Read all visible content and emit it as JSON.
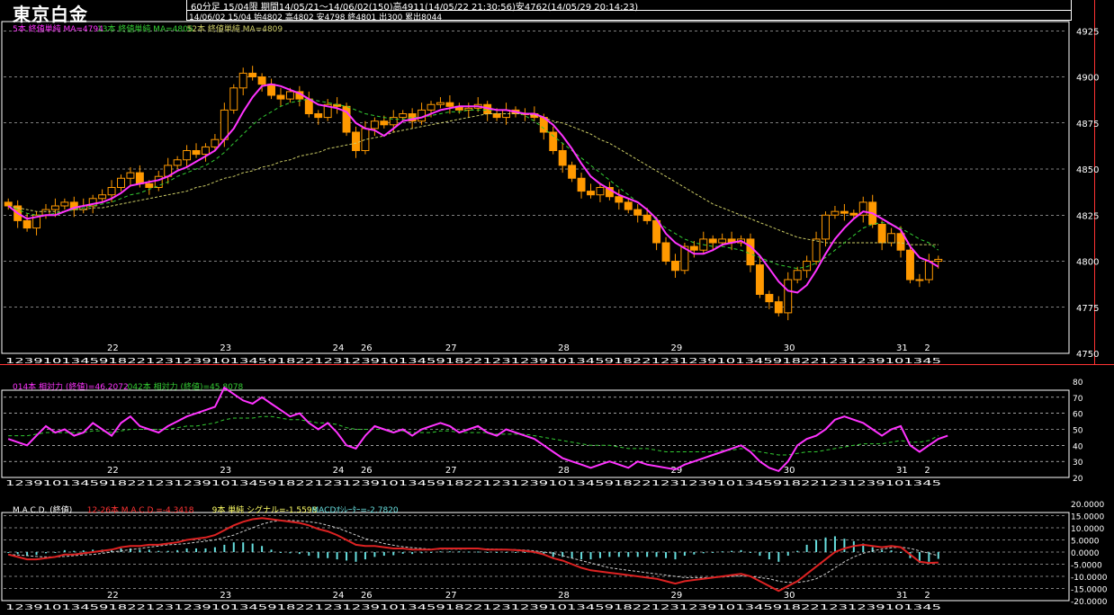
{
  "header": {
    "title": "東京白金",
    "info_line1": "60分足  15/04限  期間14/05/21～14/06/02(150)高4911(14/05/22 21:30:56)安4762(14/05/29 20:14:23)",
    "info_line2": "14/06/02 15/04 始4802 高4802 安4798 終4801 出300 累出8044"
  },
  "colors": {
    "candle": "#ff9900",
    "ma5": "#ff33ff",
    "ma13": "#33cc33",
    "ma52": "#cccc66",
    "rsi14": "#ff33ff",
    "rsi42": "#33cc33",
    "macd": "#dd2222",
    "signal": "#cccccc",
    "osc": "#66dddd",
    "panel_border": "#ff3333"
  },
  "x_axis": {
    "day_labels": [
      {
        "label": "22",
        "idx": 11
      },
      {
        "label": "23",
        "idx": 23
      },
      {
        "label": "24",
        "idx": 35
      },
      {
        "label": "26",
        "idx": 38
      },
      {
        "label": "27",
        "idx": 47
      },
      {
        "label": "28",
        "idx": 59
      },
      {
        "label": "29",
        "idx": 71
      },
      {
        "label": "30",
        "idx": 83
      },
      {
        "label": "31",
        "idx": 95
      },
      {
        "label": "2",
        "idx": 98
      }
    ],
    "hour_pattern": "123910134591822123"
  },
  "price_panel": {
    "legend": [
      {
        "text": "5本 終値単純 MA=4794",
        "color": "#ff33ff"
      },
      {
        "text": "13本 終値単純 MA=4806",
        "color": "#33cc33"
      },
      {
        "text": "52本 終値単純 MA=4809",
        "color": "#cccc66"
      }
    ],
    "y_ticks": [
      "4925",
      "4900",
      "4875",
      "4850",
      "4825",
      "4800",
      "4775",
      "4750"
    ]
  },
  "rsi_panel": {
    "legend": [
      {
        "text": "014本 相対力 (終値)=46.2072",
        "color": "#ff33ff"
      },
      {
        "text": "042本 相対力 (終値)=45.8078",
        "color": "#33cc33"
      }
    ],
    "y_ticks": [
      "80",
      "70",
      "60",
      "50",
      "40",
      "30",
      "20"
    ]
  },
  "macd_panel": {
    "legend": [
      {
        "text": "M.A.C.D. (終値)",
        "color": "#ffffff"
      },
      {
        "text": "12-26本 M.A.C.D.=-4.3418",
        "color": "#ff3333"
      },
      {
        "text": "9本 単純 シグナル=-1.5598",
        "color": "#ffff66"
      },
      {
        "text": "MACDｵｼﾚｰﾀｰ=-2.7820",
        "color": "#66dddd"
      }
    ],
    "y_ticks": [
      "20.0000",
      "15.0000",
      "10.0000",
      "5.0000",
      "0.0000",
      "-5.0000",
      "-10.0000",
      "-15.0000",
      "-20.0000"
    ]
  },
  "chart_data": {
    "type": "candlestick",
    "n_bars": 100,
    "price_ylim": [
      4750,
      4930
    ],
    "rsi_ylim": [
      20,
      80
    ],
    "macd_ylim": [
      -20,
      20
    ],
    "close": [
      4830,
      4822,
      4818,
      4825,
      4828,
      4830,
      4832,
      4828,
      4830,
      4834,
      4836,
      4840,
      4845,
      4848,
      4842,
      4840,
      4846,
      4852,
      4855,
      4860,
      4858,
      4862,
      4866,
      4882,
      4894,
      4902,
      4900,
      4896,
      4890,
      4888,
      4892,
      4888,
      4880,
      4878,
      4885,
      4884,
      4870,
      4860,
      4872,
      4876,
      4874,
      4878,
      4880,
      4876,
      4882,
      4885,
      4886,
      4884,
      4882,
      4883,
      4885,
      4880,
      4878,
      4882,
      4880,
      4880,
      4878,
      4870,
      4860,
      4852,
      4845,
      4838,
      4836,
      4840,
      4835,
      4832,
      4828,
      4825,
      4822,
      4810,
      4800,
      4795,
      4808,
      4806,
      4812,
      4810,
      4812,
      4810,
      4812,
      4798,
      4782,
      4778,
      4772,
      4790,
      4795,
      4800,
      4812,
      4825,
      4827,
      4826,
      4825,
      4832,
      4820,
      4810,
      4815,
      4806,
      4790,
      4790,
      4800,
      4801
    ],
    "ma5": [
      4830,
      4826,
      4823,
      4824,
      4825,
      4825,
      4827,
      4829,
      4830,
      4831,
      4832,
      4834,
      4837,
      4841,
      4842,
      4843,
      4844,
      4846,
      4849,
      4851,
      4854,
      4857,
      4860,
      4866,
      4872,
      4881,
      4889,
      4895,
      4896,
      4895,
      4893,
      4891,
      4888,
      4885,
      4884,
      4883,
      4881,
      4875,
      4872,
      4871,
      4868,
      4872,
      4876,
      4877,
      4878,
      4880,
      4882,
      4883,
      4884,
      4884,
      4884,
      4883,
      4882,
      4882,
      4881,
      4880,
      4880,
      4878,
      4874,
      4868,
      4861,
      4853,
      4846,
      4842,
      4839,
      4836,
      4834,
      4832,
      4828,
      4823,
      4815,
      4810,
      4807,
      4804,
      4804,
      4806,
      4809,
      4810,
      4811,
      4808,
      4803,
      4796,
      4789,
      4784,
      4783,
      4787,
      4795,
      4804,
      4812,
      4818,
      4823,
      4827,
      4826,
      4823,
      4820,
      4817,
      4808,
      4802,
      4800,
      4797
    ],
    "ma13": [
      4830,
      4828,
      4826,
      4825,
      4825,
      4826,
      4827,
      4828,
      4829,
      4830,
      4831,
      4832,
      4834,
      4836,
      4837,
      4839,
      4841,
      4843,
      4846,
      4848,
      4850,
      4852,
      4855,
      4859,
      4864,
      4869,
      4874,
      4878,
      4881,
      4884,
      4886,
      4887,
      4888,
      4887,
      4886,
      4885,
      4884,
      4882,
      4880,
      4879,
      4878,
      4877,
      4877,
      4878,
      4878,
      4879,
      4880,
      4881,
      4881,
      4882,
      4882,
      4882,
      4882,
      4882,
      4881,
      4879,
      4876,
      4872,
      4868,
      4864,
      4860,
      4856,
      4852,
      4848,
      4844,
      4840,
      4836,
      4832,
      4828,
      4822,
      4818,
      4815,
      4812,
      4810,
      4809,
      4808,
      4808,
      4807,
      4806,
      4804,
      4802,
      4800,
      4798,
      4797,
      4796,
      4797,
      4799,
      4802,
      4806,
      4810,
      4814,
      4818,
      4820,
      4821,
      4820,
      4818,
      4815,
      4812,
      4810,
      4806
    ],
    "ma52": [
      4830,
      4829,
      4828,
      4827,
      4827,
      4827,
      4827,
      4828,
      4828,
      4829,
      4829,
      4830,
      4831,
      4832,
      4833,
      4834,
      4835,
      4836,
      4837,
      4838,
      4840,
      4841,
      4843,
      4845,
      4846,
      4848,
      4849,
      4851,
      4852,
      4854,
      4855,
      4857,
      4858,
      4859,
      4861,
      4862,
      4863,
      4864,
      4866,
      4867,
      4868,
      4870,
      4871,
      4872,
      4873,
      4874,
      4875,
      4876,
      4877,
      4878,
      4879,
      4880,
      4880,
      4880,
      4880,
      4880,
      4879,
      4878,
      4876,
      4875,
      4873,
      4871,
      4869,
      4866,
      4864,
      4861,
      4858,
      4855,
      4852,
      4849,
      4846,
      4843,
      4840,
      4837,
      4834,
      4831,
      4829,
      4827,
      4825,
      4823,
      4821,
      4819,
      4817,
      4815,
      4813,
      4812,
      4811,
      4810,
      4810,
      4810,
      4810,
      4810,
      4810,
      4810,
      4810,
      4810,
      4809,
      4809,
      4809,
      4809
    ],
    "rsi14": [
      44,
      42,
      40,
      46,
      52,
      48,
      50,
      46,
      48,
      54,
      50,
      46,
      54,
      58,
      52,
      50,
      48,
      52,
      55,
      58,
      60,
      62,
      64,
      76,
      72,
      68,
      66,
      70,
      66,
      62,
      58,
      60,
      54,
      50,
      54,
      48,
      40,
      38,
      46,
      52,
      50,
      48,
      50,
      46,
      50,
      52,
      54,
      52,
      48,
      50,
      52,
      48,
      46,
      50,
      48,
      46,
      44,
      40,
      36,
      32,
      30,
      28,
      26,
      28,
      30,
      28,
      26,
      30,
      28,
      27,
      26,
      25,
      28,
      30,
      32,
      34,
      36,
      38,
      40,
      36,
      30,
      26,
      24,
      30,
      40,
      44,
      46,
      50,
      56,
      58,
      56,
      54,
      50,
      46,
      50,
      52,
      40,
      36,
      40,
      44,
      46
    ],
    "rsi42": [
      46,
      46,
      46,
      47,
      48,
      48,
      48,
      48,
      48,
      49,
      49,
      48,
      49,
      50,
      50,
      50,
      50,
      50,
      51,
      52,
      52,
      53,
      54,
      56,
      57,
      57,
      57,
      58,
      58,
      57,
      56,
      56,
      55,
      54,
      54,
      53,
      51,
      50,
      50,
      50,
      50,
      49,
      49,
      48,
      48,
      48,
      49,
      49,
      48,
      48,
      48,
      48,
      47,
      47,
      47,
      47,
      46,
      45,
      44,
      43,
      42,
      41,
      40,
      40,
      40,
      39,
      38,
      38,
      38,
      37,
      36,
      36,
      36,
      36,
      36,
      36,
      37,
      37,
      38,
      37,
      36,
      35,
      34,
      34,
      35,
      36,
      36,
      37,
      38,
      39,
      40,
      41,
      41,
      41,
      42,
      43,
      42,
      42,
      43,
      46
    ],
    "macd": [
      -1.0,
      -2.0,
      -3.0,
      -3.0,
      -2.5,
      -2.0,
      -1.0,
      -1.0,
      -0.5,
      0.0,
      0.5,
      1.0,
      2.0,
      2.5,
      2.5,
      3.0,
      3.0,
      3.5,
      4.0,
      5.0,
      5.5,
      6.0,
      7.0,
      9.0,
      11.0,
      12.5,
      13.5,
      14.0,
      13.5,
      13.0,
      12.5,
      12.0,
      11.0,
      9.5,
      8.5,
      7.0,
      5.0,
      3.0,
      2.5,
      2.5,
      2.0,
      1.5,
      1.5,
      1.0,
      1.0,
      1.0,
      1.5,
      1.5,
      1.5,
      1.5,
      1.5,
      1.0,
      1.0,
      1.0,
      0.8,
      0.5,
      0.0,
      -1.0,
      -2.5,
      -3.5,
      -5.0,
      -6.5,
      -7.5,
      -8.0,
      -8.5,
      -9.0,
      -9.5,
      -10.0,
      -10.5,
      -11.0,
      -12.0,
      -13.0,
      -12.0,
      -11.5,
      -11.0,
      -10.5,
      -10.0,
      -9.5,
      -9.0,
      -10.0,
      -12.0,
      -14.0,
      -16.0,
      -14.0,
      -12.0,
      -9.0,
      -6.0,
      -3.0,
      0.0,
      1.5,
      2.5,
      3.0,
      2.5,
      2.0,
      2.5,
      2.0,
      -1.0,
      -4.0,
      -4.5,
      -4.3
    ],
    "signal": [
      -1.0,
      -1.2,
      -1.5,
      -1.8,
      -2.0,
      -2.0,
      -1.8,
      -1.5,
      -1.2,
      -1.0,
      -0.5,
      0.0,
      0.5,
      1.0,
      1.5,
      2.0,
      2.5,
      3.0,
      3.2,
      3.5,
      4.0,
      4.5,
      5.0,
      6.0,
      7.0,
      8.5,
      10.0,
      11.5,
      12.5,
      13.0,
      13.0,
      12.8,
      12.5,
      12.0,
      11.0,
      10.0,
      8.5,
      7.0,
      5.5,
      4.5,
      3.5,
      2.8,
      2.2,
      1.8,
      1.5,
      1.2,
      1.2,
      1.2,
      1.2,
      1.3,
      1.3,
      1.3,
      1.2,
      1.1,
      1.0,
      0.8,
      0.5,
      0.0,
      -0.5,
      -1.5,
      -2.5,
      -3.5,
      -4.5,
      -5.5,
      -6.5,
      -7.0,
      -7.5,
      -8.0,
      -8.5,
      -9.0,
      -9.5,
      -10.0,
      -10.5,
      -10.5,
      -10.5,
      -10.5,
      -10.3,
      -10.0,
      -9.8,
      -10.0,
      -10.5,
      -11.0,
      -12.0,
      -12.5,
      -12.5,
      -12.0,
      -11.0,
      -9.0,
      -6.5,
      -4.0,
      -2.0,
      -0.5,
      0.5,
      1.2,
      1.8,
      2.0,
      1.5,
      0.5,
      -0.5,
      -1.5
    ]
  }
}
